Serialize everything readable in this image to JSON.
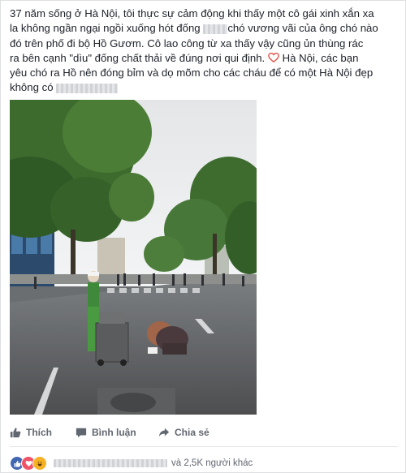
{
  "post": {
    "line1": "37 năm sống ở Hà Nội, tôi thực sự cảm động khi thấy một cô gái xinh xắn xa",
    "line2_a": "la không ngần ngại ngồi xuống hót đống",
    "line2_b": "chó vương vãi của ông chó nào",
    "line3": "đó trên phố đi bộ Hồ Gươm. Cô lao công từ xa thấy vậy cũng ủn thùng rác",
    "line4_a": "ra bên cạnh \"dìu\" đống chất thải về đúng nơi qui định.",
    "line4_b": "Hà Nội, các bạn",
    "line5": "yêu chó ra Hồ nên đóng bỉm và dọ mõm cho các cháu để có một Hà Nội đẹp",
    "line6": "không có"
  },
  "actions": {
    "like_label": "Thích",
    "comment_label": "Bình luận",
    "share_label": "Chia sẻ"
  },
  "reactions": {
    "icons": [
      "like-icon",
      "love-icon",
      "haha-icon"
    ],
    "others_text": "và 2,5K người khác"
  },
  "colors": {
    "text": "#1d2129",
    "muted": "#616770",
    "like_blue": "#4267b2",
    "love_red": "#f25268",
    "haha_yellow": "#f7b125"
  }
}
